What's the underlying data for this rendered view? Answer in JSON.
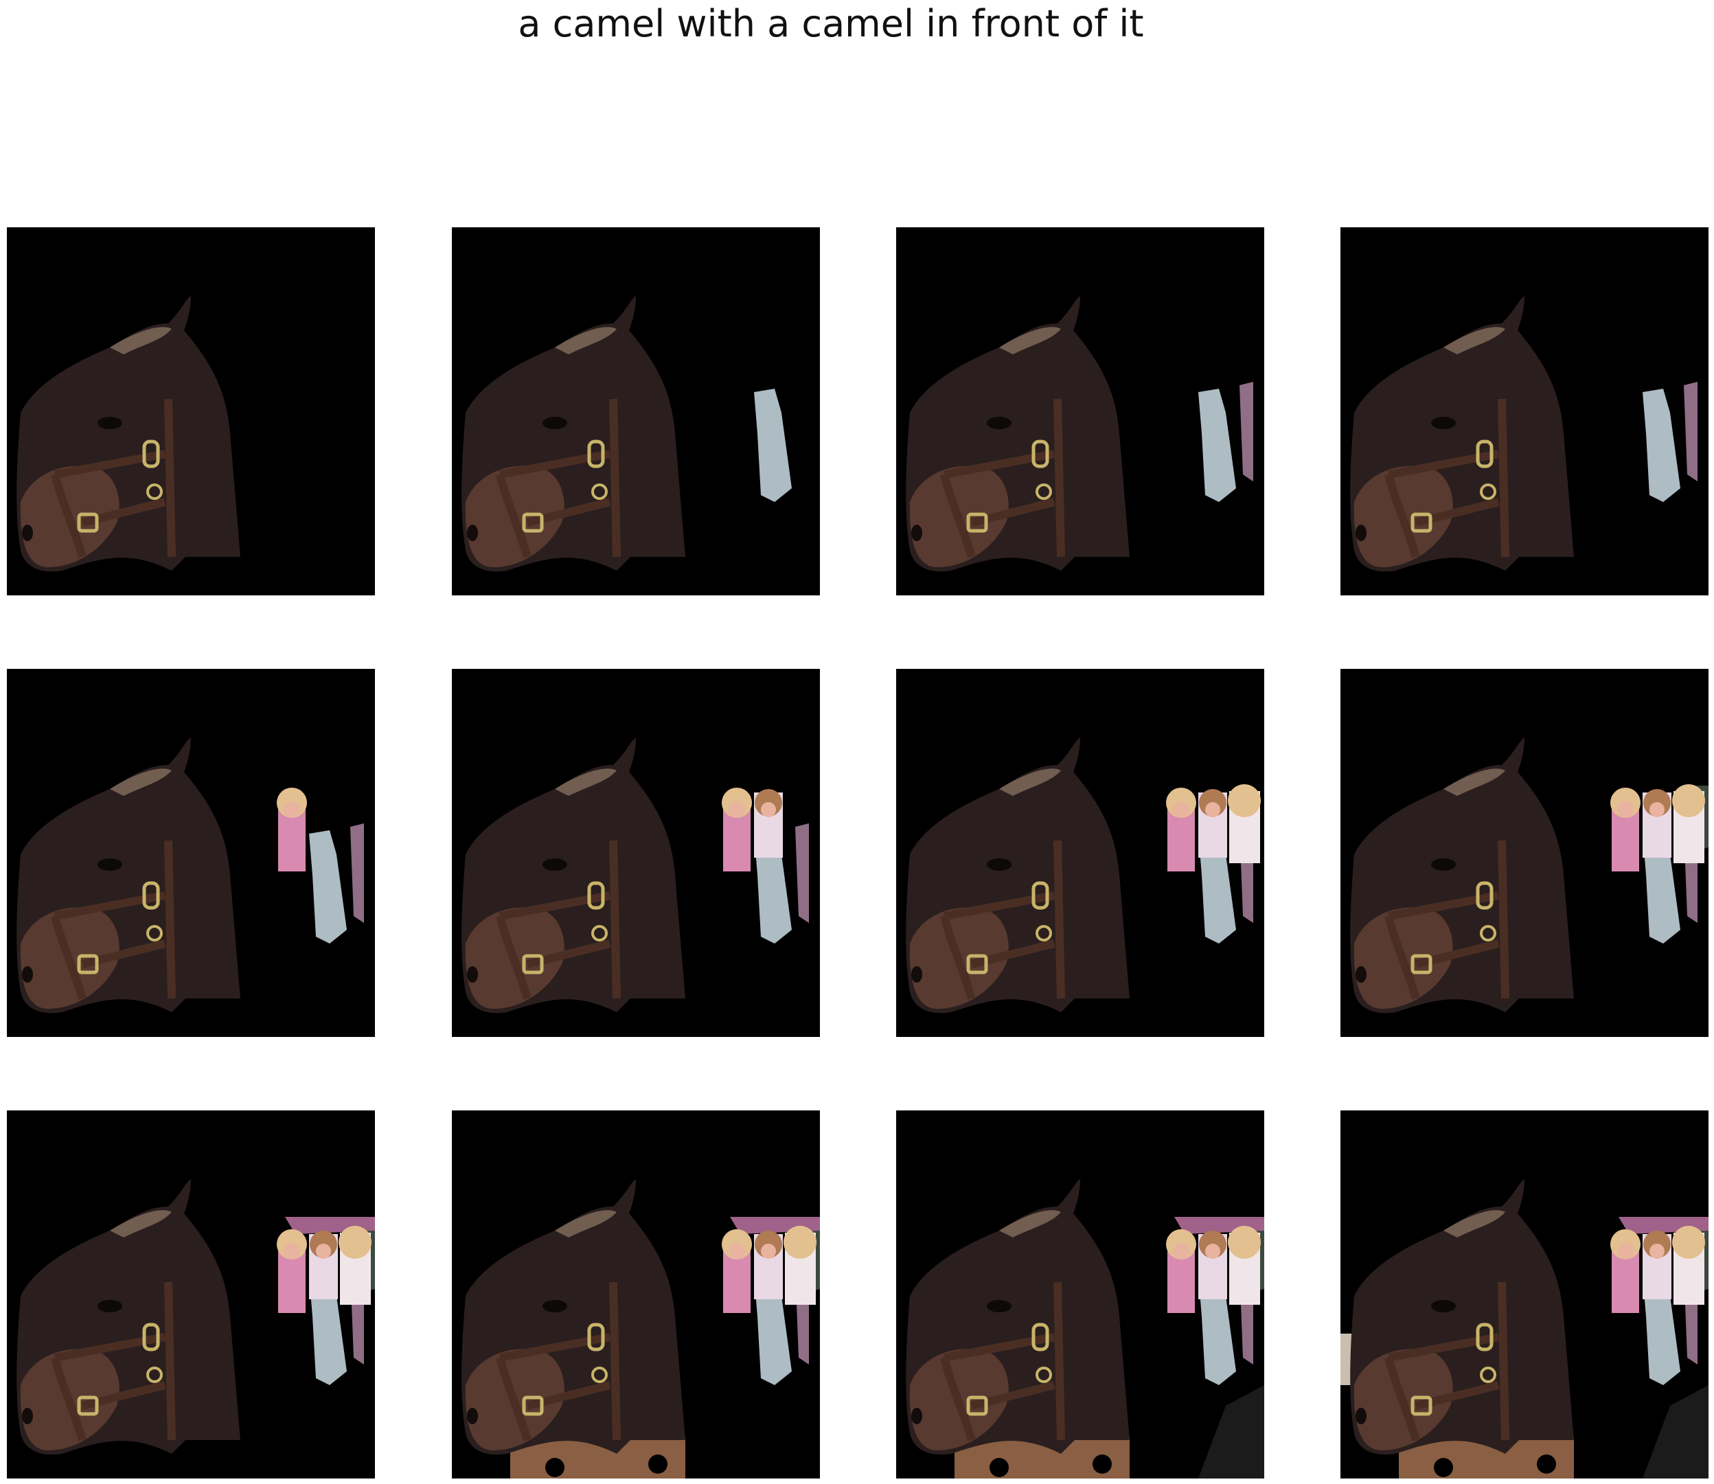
{
  "figure": {
    "title": "a camel with a camel in front of it"
  },
  "panels": [
    {
      "row": 0,
      "col": 0,
      "layers": []
    },
    {
      "row": 0,
      "col": 1,
      "layers": [
        "person-cutout-1"
      ]
    },
    {
      "row": 0,
      "col": 2,
      "layers": [
        "person-cutout-1",
        "person-cutout-2"
      ]
    },
    {
      "row": 0,
      "col": 3,
      "layers": [
        "person-cutout-1",
        "person-cutout-2"
      ]
    },
    {
      "row": 1,
      "col": 0,
      "layers": [
        "person-cutout-1",
        "person-cutout-2",
        "girl-cutout-1"
      ]
    },
    {
      "row": 1,
      "col": 1,
      "layers": [
        "person-cutout-1",
        "person-cutout-2",
        "girl-cutout-1",
        "girl-cutout-2"
      ]
    },
    {
      "row": 1,
      "col": 2,
      "layers": [
        "person-cutout-1",
        "person-cutout-2",
        "girl-cutout-1",
        "girl-cutout-2",
        "girl-cutout-3"
      ]
    },
    {
      "row": 1,
      "col": 3,
      "layers": [
        "person-cutout-1",
        "person-cutout-2",
        "girl-cutout-1",
        "girl-cutout-2",
        "girl-cutout-3",
        "dark-cutout-1"
      ]
    },
    {
      "row": 2,
      "col": 0,
      "layers": [
        "person-cutout-1",
        "person-cutout-2",
        "girl-cutout-1",
        "girl-cutout-2",
        "girl-cutout-3",
        "dark-cutout-1",
        "pink-cutout-1"
      ]
    },
    {
      "row": 2,
      "col": 1,
      "layers": [
        "person-cutout-1",
        "person-cutout-2",
        "girl-cutout-1",
        "girl-cutout-2",
        "girl-cutout-3",
        "dark-cutout-1",
        "pink-cutout-1",
        "ground-cutout",
        "box-cutout"
      ]
    },
    {
      "row": 2,
      "col": 2,
      "layers": [
        "person-cutout-1",
        "person-cutout-2",
        "girl-cutout-1",
        "girl-cutout-2",
        "girl-cutout-3",
        "dark-cutout-1",
        "pink-cutout-1",
        "ground-cutout",
        "box-cutout",
        "dark-cutout-2"
      ]
    },
    {
      "row": 2,
      "col": 3,
      "layers": [
        "person-cutout-1",
        "person-cutout-2",
        "girl-cutout-1",
        "girl-cutout-2",
        "girl-cutout-3",
        "dark-cutout-1",
        "pink-cutout-1",
        "ground-cutout",
        "box-cutout",
        "dark-cutout-2",
        "sand-cutout"
      ]
    }
  ],
  "colors": {
    "background": "#000000",
    "horse_dark": "#2a1f1e",
    "horse_muzzle": "#6a4437",
    "halter": "#4a2e24",
    "buckle": "#c8b46a",
    "mane": "#7a6457",
    "person_cutout": "#aebcc4",
    "girl_hair": "#e3c08f",
    "girl_skin": "#e8b39f",
    "girl_top": "#d98ab0",
    "ground": "#8a5f43"
  }
}
